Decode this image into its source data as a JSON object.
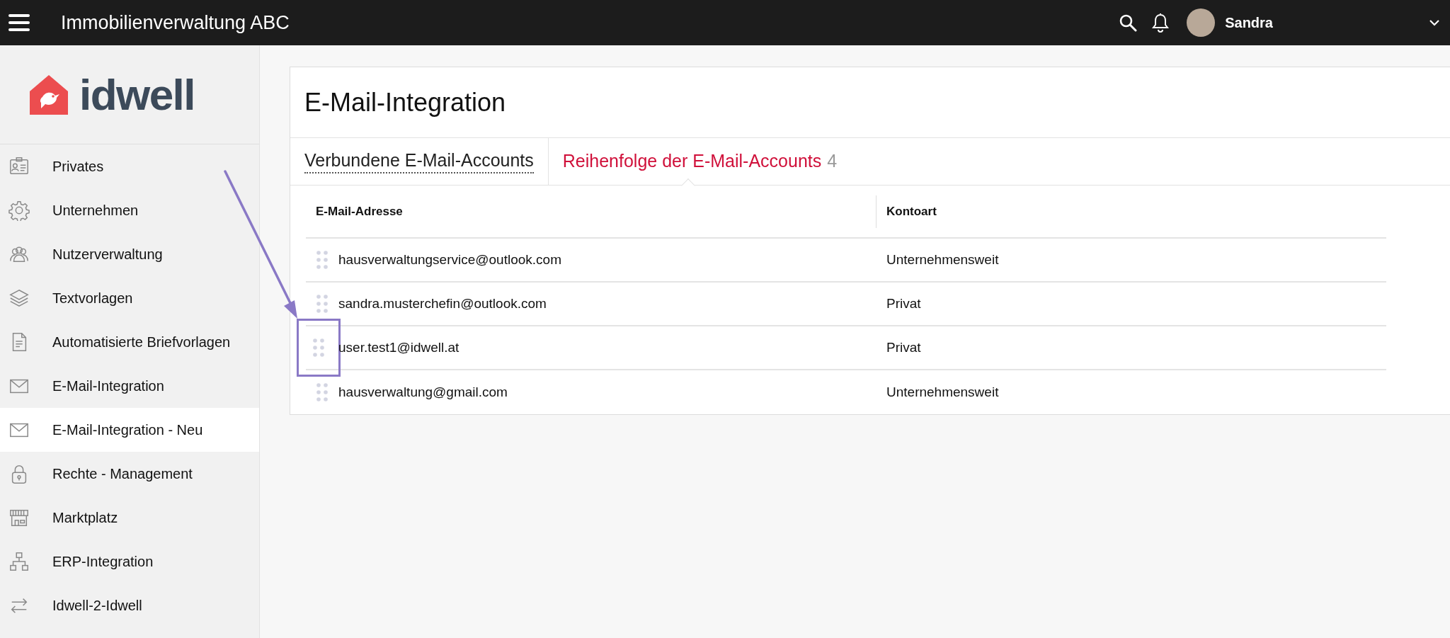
{
  "top_bar": {
    "title": "Immobilienverwaltung ABC",
    "user": "Sandra"
  },
  "logo": {
    "text": "idwell"
  },
  "sidebar": {
    "items": [
      {
        "label": "Privates",
        "selected": false
      },
      {
        "label": "Unternehmen",
        "selected": false
      },
      {
        "label": "Nutzerverwaltung",
        "selected": false
      },
      {
        "label": "Textvorlagen",
        "selected": false
      },
      {
        "label": "Automatisierte Briefvorlagen",
        "selected": false
      },
      {
        "label": "E-Mail-Integration",
        "selected": false
      },
      {
        "label": "E-Mail-Integration - Neu",
        "selected": true
      },
      {
        "label": "Rechte - Management",
        "selected": false
      },
      {
        "label": "Marktplatz",
        "selected": false
      },
      {
        "label": "ERP-Integration",
        "selected": false
      },
      {
        "label": "Idwell-2-Idwell",
        "selected": false
      }
    ]
  },
  "page": {
    "title": "E-Mail-Integration",
    "tabs": [
      {
        "label": "Verbundene E-Mail-Accounts",
        "selected": false
      },
      {
        "label": "Reihenfolge der E-Mail-Accounts",
        "count": "4",
        "selected": true
      }
    ],
    "table": {
      "columns": [
        "E-Mail-Adresse",
        "Kontoart"
      ],
      "rows": [
        {
          "email": "hausverwaltungservice@outlook.com",
          "type": "Unternehmensweit",
          "highlighted": false
        },
        {
          "email": "sandra.musterchefin@outlook.com",
          "type": "Privat",
          "highlighted": false
        },
        {
          "email": "user.test1@idwell.at",
          "type": "Privat",
          "highlighted": true
        },
        {
          "email": "hausverwaltung@gmail.com",
          "type": "Unternehmensweit",
          "highlighted": false
        }
      ]
    }
  }
}
